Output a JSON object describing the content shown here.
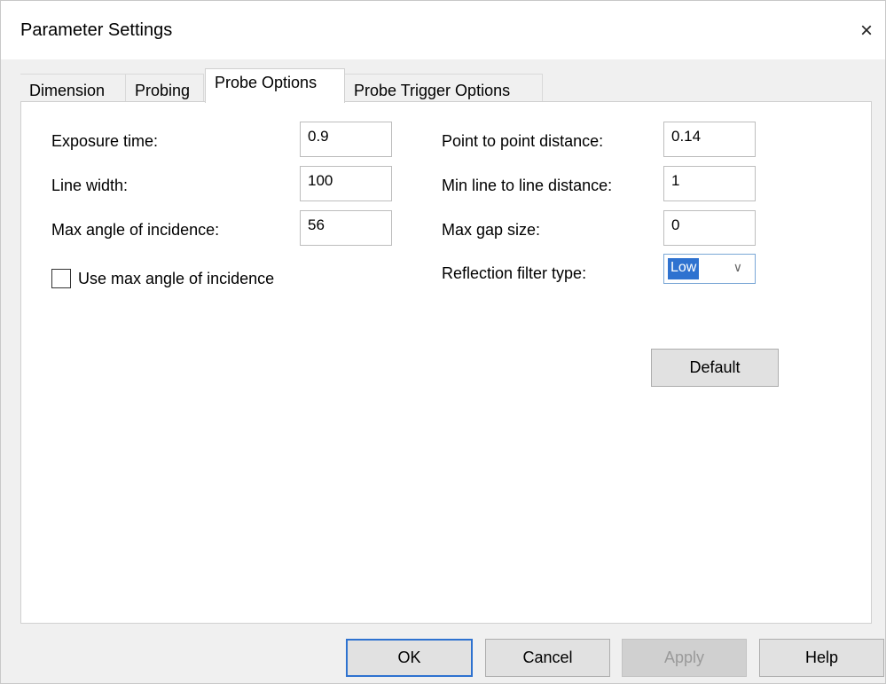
{
  "dialog": {
    "title": "Parameter Settings",
    "close_label": "×"
  },
  "tabs": [
    {
      "label": "Dimension"
    },
    {
      "label": "Probing"
    },
    {
      "label": "Probe Options",
      "active": true
    },
    {
      "label": "Probe Trigger Options"
    }
  ],
  "left_fields": [
    {
      "label": "Exposure time:",
      "value": "0.9"
    },
    {
      "label": "Line width:",
      "value": "100"
    },
    {
      "label": "Max angle of incidence:",
      "value": "56"
    }
  ],
  "checkbox": {
    "label": "Use max angle of incidence",
    "checked": false
  },
  "right_fields": [
    {
      "label": "Point to point distance:",
      "value": "0.14"
    },
    {
      "label": "Min line to line distance:",
      "value": "1"
    },
    {
      "label": "Max gap size:",
      "value": "0"
    }
  ],
  "reflection_filter": {
    "label": "Reflection filter type:",
    "value": "Low",
    "icon": "chevron-down-icon"
  },
  "default_button": "Default",
  "footer": {
    "ok": "OK",
    "cancel": "Cancel",
    "apply": "Apply",
    "help": "Help"
  },
  "colors": {
    "accent": "#2e72d0",
    "disabled_text": "#9a9a9a"
  }
}
